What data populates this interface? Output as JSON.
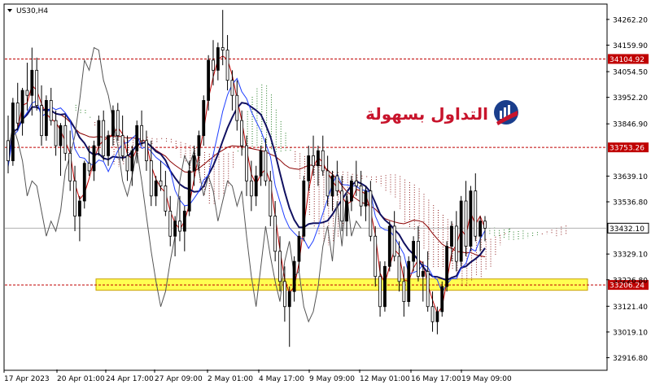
{
  "chart_data": {
    "type": "candlestick",
    "symbol_label": "US30,H4",
    "ylim": [
      32870,
      34320
    ],
    "y_ticks": [
      {
        "v": 34262.2,
        "t": "34262.20"
      },
      {
        "v": 34159.9,
        "t": "34159.90"
      },
      {
        "v": 34054.5,
        "t": "34054.50"
      },
      {
        "v": 33952.2,
        "t": "33952.20"
      },
      {
        "v": 33846.9,
        "t": "33846.90"
      },
      {
        "v": 33639.1,
        "t": "33639.10"
      },
      {
        "v": 33536.8,
        "t": "33536.80"
      },
      {
        "v": 33329.1,
        "t": "33329.10"
      },
      {
        "v": 33226.8,
        "t": "33226.80"
      },
      {
        "v": 33121.4,
        "t": "33121.40"
      },
      {
        "v": 33019.1,
        "t": "33019.10"
      },
      {
        "v": 32916.8,
        "t": "32916.80"
      }
    ],
    "x_ticks": [
      "17 Apr 2023",
      "20 Apr 01:00",
      "24 Apr 17:00",
      "27 Apr 09:00",
      "2 May 01:00",
      "4 May 17:00",
      "9 May 09:00",
      "12 May 01:00",
      "16 May 17:00",
      "19 May 09:00"
    ],
    "levels": [
      {
        "value": 34104.92,
        "label": "34104.92",
        "color": "#c00000"
      },
      {
        "value": 33753.26,
        "label": "33753.26",
        "color": "#c00000"
      },
      {
        "value": 33206.24,
        "label": "33206.24",
        "color": "#c00000"
      }
    ],
    "current_price": {
      "value": 33432.1,
      "label": "33432.10"
    },
    "support_zone": [
      33185,
      33230
    ],
    "ohlc": [
      [
        33780,
        33880,
        33650,
        33700
      ],
      [
        33700,
        33950,
        33680,
        33930
      ],
      [
        33930,
        34010,
        33820,
        33850
      ],
      [
        33850,
        33990,
        33800,
        33980
      ],
      [
        33980,
        34090,
        33900,
        33960
      ],
      [
        33960,
        34150,
        33880,
        34060
      ],
      [
        34060,
        34110,
        33900,
        33920
      ],
      [
        33920,
        34000,
        33760,
        33800
      ],
      [
        33800,
        33960,
        33780,
        33940
      ],
      [
        33940,
        33990,
        33840,
        33860
      ],
      [
        33860,
        33900,
        33720,
        33760
      ],
      [
        33760,
        33850,
        33640,
        33840
      ],
      [
        33840,
        33880,
        33700,
        33730
      ],
      [
        33730,
        33820,
        33580,
        33620
      ],
      [
        33620,
        33680,
        33420,
        33480
      ],
      [
        33480,
        33560,
        33380,
        33540
      ],
      [
        33540,
        33700,
        33510,
        33690
      ],
      [
        33690,
        33760,
        33640,
        33660
      ],
      [
        33660,
        33780,
        33620,
        33760
      ],
      [
        33760,
        33880,
        33720,
        33860
      ],
      [
        33860,
        33900,
        33700,
        33720
      ],
      [
        33720,
        33820,
        33680,
        33800
      ],
      [
        33800,
        33920,
        33760,
        33900
      ],
      [
        33900,
        33930,
        33780,
        33800
      ],
      [
        33800,
        33880,
        33700,
        33720
      ],
      [
        33720,
        33800,
        33620,
        33660
      ],
      [
        33660,
        33760,
        33600,
        33740
      ],
      [
        33740,
        33860,
        33690,
        33840
      ],
      [
        33840,
        33900,
        33760,
        33780
      ],
      [
        33780,
        33820,
        33660,
        33700
      ],
      [
        33700,
        33780,
        33520,
        33560
      ],
      [
        33560,
        33640,
        33520,
        33620
      ],
      [
        33620,
        33700,
        33580,
        33600
      ],
      [
        33600,
        33660,
        33480,
        33500
      ],
      [
        33500,
        33560,
        33360,
        33400
      ],
      [
        33400,
        33480,
        33320,
        33460
      ],
      [
        33460,
        33560,
        33380,
        33420
      ],
      [
        33420,
        33520,
        33340,
        33500
      ],
      [
        33500,
        33700,
        33480,
        33660
      ],
      [
        33660,
        33760,
        33600,
        33720
      ],
      [
        33720,
        33820,
        33660,
        33800
      ],
      [
        33800,
        33960,
        33760,
        33940
      ],
      [
        33940,
        34120,
        33900,
        34100
      ],
      [
        34100,
        34180,
        34000,
        34060
      ],
      [
        34060,
        34170,
        34020,
        34150
      ],
      [
        34150,
        34300,
        34080,
        34140
      ],
      [
        34140,
        34200,
        33980,
        34020
      ],
      [
        34020,
        34060,
        33900,
        33960
      ],
      [
        33960,
        34020,
        33820,
        33860
      ],
      [
        33860,
        33900,
        33720,
        33760
      ],
      [
        33760,
        33800,
        33560,
        33620
      ],
      [
        33620,
        33700,
        33500,
        33560
      ],
      [
        33560,
        33680,
        33520,
        33640
      ],
      [
        33640,
        33760,
        33600,
        33740
      ],
      [
        33740,
        33790,
        33600,
        33620
      ],
      [
        33620,
        33660,
        33440,
        33480
      ],
      [
        33480,
        33540,
        33300,
        33340
      ],
      [
        33340,
        33400,
        33180,
        33220
      ],
      [
        33220,
        33280,
        33060,
        33120
      ],
      [
        33120,
        33200,
        32960,
        33180
      ],
      [
        33180,
        33320,
        33140,
        33300
      ],
      [
        33300,
        33420,
        33260,
        33400
      ],
      [
        33400,
        33640,
        33380,
        33620
      ],
      [
        33620,
        33760,
        33580,
        33720
      ],
      [
        33720,
        33800,
        33640,
        33680
      ],
      [
        33680,
        33760,
        33600,
        33740
      ],
      [
        33740,
        33800,
        33640,
        33660
      ],
      [
        33660,
        33720,
        33520,
        33560
      ],
      [
        33560,
        33660,
        33500,
        33640
      ],
      [
        33640,
        33700,
        33560,
        33580
      ],
      [
        33580,
        33640,
        33420,
        33460
      ],
      [
        33460,
        33560,
        33400,
        33540
      ],
      [
        33540,
        33640,
        33500,
        33620
      ],
      [
        33620,
        33700,
        33560,
        33600
      ],
      [
        33600,
        33660,
        33480,
        33520
      ],
      [
        33520,
        33600,
        33460,
        33580
      ],
      [
        33580,
        33620,
        33380,
        33400
      ],
      [
        33400,
        33440,
        33200,
        33240
      ],
      [
        33240,
        33300,
        33080,
        33120
      ],
      [
        33120,
        33300,
        33100,
        33280
      ],
      [
        33280,
        33460,
        33260,
        33440
      ],
      [
        33440,
        33500,
        33300,
        33320
      ],
      [
        33320,
        33380,
        33180,
        33220
      ],
      [
        33220,
        33280,
        33080,
        33140
      ],
      [
        33140,
        33320,
        33120,
        33300
      ],
      [
        33300,
        33400,
        33260,
        33380
      ],
      [
        33380,
        33440,
        33220,
        33240
      ],
      [
        33240,
        33300,
        33140,
        33260
      ],
      [
        33260,
        33340,
        33100,
        33120
      ],
      [
        33120,
        33180,
        33020,
        33060
      ],
      [
        33060,
        33120,
        33010,
        33100
      ],
      [
        33100,
        33220,
        33080,
        33200
      ],
      [
        33200,
        33380,
        33180,
        33360
      ],
      [
        33360,
        33460,
        33300,
        33440
      ],
      [
        33440,
        33500,
        33260,
        33300
      ],
      [
        33300,
        33560,
        33280,
        33540
      ],
      [
        33540,
        33620,
        33320,
        33360
      ],
      [
        33360,
        33600,
        33340,
        33580
      ],
      [
        33580,
        33650,
        33380,
        33400
      ],
      [
        33400,
        33480,
        33340,
        33460
      ],
      [
        33460,
        33480,
        33380,
        33432
      ]
    ]
  }
}
